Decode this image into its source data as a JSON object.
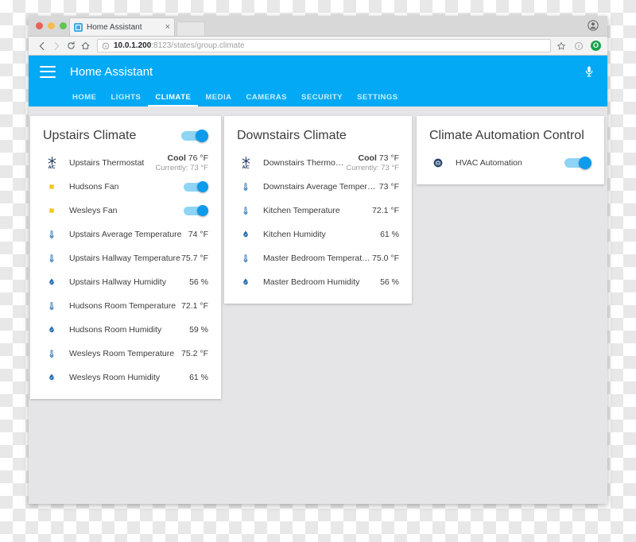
{
  "browser": {
    "tab_title": "Home Assistant",
    "tab_close_label": "×",
    "url_host": "10.0.1.200",
    "url_rest": ":8123/states/group.climate",
    "back_icon": "back-arrow-icon",
    "forward_icon": "forward-arrow-icon",
    "reload_icon": "reload-icon",
    "home_icon": "home-icon",
    "info_icon": "page-info-icon",
    "bookmark_icon": "star-icon",
    "extension_icon": "extension-icon",
    "profile_avatar_letter": "O"
  },
  "app": {
    "title": "Home Assistant",
    "menu_icon": "hamburger-menu-icon",
    "mic_icon": "microphone-icon",
    "accent_color": "#03a9f4",
    "tabs": [
      {
        "label": "HOME",
        "active": false
      },
      {
        "label": "LIGHTS",
        "active": false
      },
      {
        "label": "CLIMATE",
        "active": true
      },
      {
        "label": "MEDIA",
        "active": false
      },
      {
        "label": "CAMERAS",
        "active": false
      },
      {
        "label": "SECURITY",
        "active": false
      },
      {
        "label": "SETTINGS",
        "active": false
      }
    ]
  },
  "cards": {
    "upstairs": {
      "title": "Upstairs Climate",
      "header_toggle": "on",
      "rows": [
        {
          "icon": "ac-icon",
          "name": "Upstairs Thermostat",
          "value_primary_bold": "Cool",
          "value_primary_rest": " 76 °F",
          "value_secondary": "Currently: 73 °F",
          "type": "thermostat"
        },
        {
          "icon": "fan-icon",
          "name": "Hudsons Fan",
          "type": "toggle",
          "toggle": "on"
        },
        {
          "icon": "fan-icon",
          "name": "Wesleys Fan",
          "type": "toggle",
          "toggle": "on"
        },
        {
          "icon": "thermometer-icon",
          "name": "Upstairs Average Temperature",
          "value": "74 °F",
          "type": "value"
        },
        {
          "icon": "thermometer-icon",
          "name": "Upstairs Hallway Temperature",
          "value": "75.7 °F",
          "type": "value"
        },
        {
          "icon": "water-drop-icon",
          "name": "Upstairs Hallway Humidity",
          "value": "56 %",
          "type": "value"
        },
        {
          "icon": "thermometer-icon",
          "name": "Hudsons Room Temperature",
          "value": "72.1 °F",
          "type": "value"
        },
        {
          "icon": "water-drop-icon",
          "name": "Hudsons Room Humidity",
          "value": "59 %",
          "type": "value"
        },
        {
          "icon": "thermometer-icon",
          "name": "Wesleys Room Temperature",
          "value": "75.2 °F",
          "type": "value"
        },
        {
          "icon": "water-drop-icon",
          "name": "Wesleys Room Humidity",
          "value": "61 %",
          "type": "value"
        }
      ]
    },
    "downstairs": {
      "title": "Downstairs Climate",
      "rows": [
        {
          "icon": "ac-icon",
          "name": "Downstairs Thermostat",
          "value_primary_bold": "Cool",
          "value_primary_rest": " 73 °F",
          "value_secondary": "Currently: 73 °F",
          "type": "thermostat"
        },
        {
          "icon": "thermometer-icon",
          "name": "Downstairs Average Temperature",
          "value": "73 °F",
          "type": "value"
        },
        {
          "icon": "thermometer-icon",
          "name": "Kitchen Temperature",
          "value": "72.1 °F",
          "type": "value"
        },
        {
          "icon": "water-drop-icon",
          "name": "Kitchen Humidity",
          "value": "61 %",
          "type": "value"
        },
        {
          "icon": "thermometer-icon",
          "name": "Master Bedroom Temperature",
          "value": "75.0 °F",
          "type": "value"
        },
        {
          "icon": "water-drop-icon",
          "name": "Master Bedroom Humidity",
          "value": "56 %",
          "type": "value"
        }
      ]
    },
    "automation": {
      "title": "Climate Automation Control",
      "rows": [
        {
          "icon": "robot-icon",
          "name": "HVAC Automation",
          "type": "toggle",
          "toggle": "on"
        }
      ]
    }
  },
  "ac_icon_label": "A/C"
}
